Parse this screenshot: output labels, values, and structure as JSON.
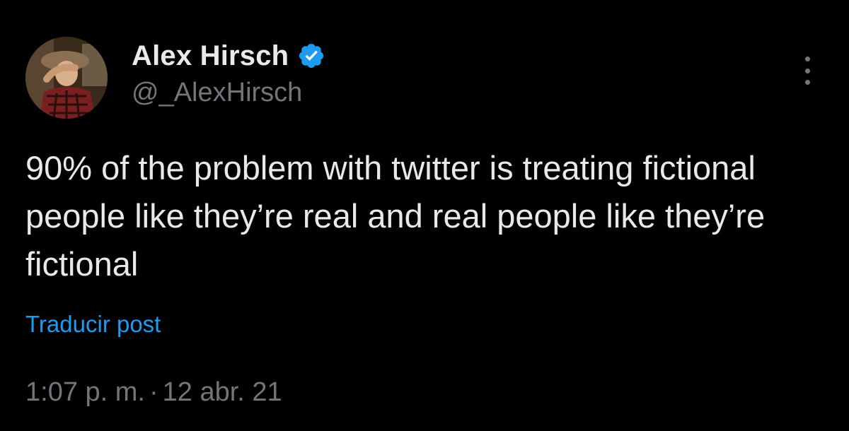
{
  "author": {
    "display_name": "Alex Hirsch",
    "handle": "@_AlexHirsch",
    "verified": true,
    "avatar_icon": "profile-photo"
  },
  "post": {
    "text": "90% of the problem with twitter is treating fictional people like they’re real and real people like they’re fictional",
    "translate_label": "Traducir post",
    "time": "1:07 p. m.",
    "separator": "·",
    "date": "12 abr. 21"
  },
  "colors": {
    "background": "#000000",
    "primary_text": "#e7e9ea",
    "secondary_text": "#71767b",
    "link": "#1d9bf0",
    "verified_badge": "#1d9bf0"
  },
  "icons": {
    "verified": "verified-badge-icon",
    "more": "more-options-icon"
  }
}
